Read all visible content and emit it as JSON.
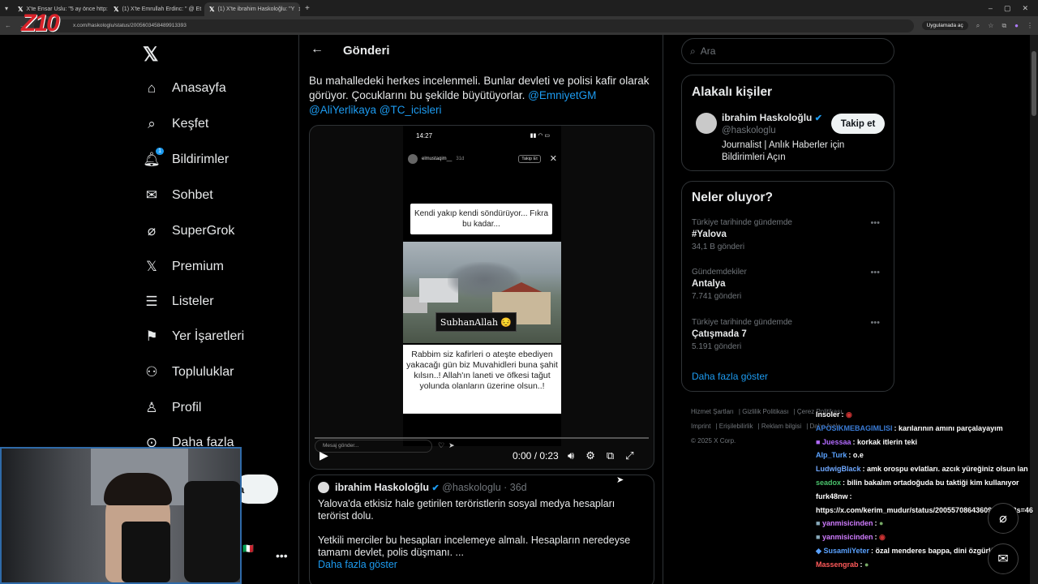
{
  "browser": {
    "tabs": [
      {
        "title": "X'te Ensar Uslu: \"5 ay önce http:",
        "active": false
      },
      {
        "title": "(1) X'te Emrullah Erdinc: \" @ Et",
        "active": false
      },
      {
        "title": "(1) X'te ibrahim Haskoloğlu: \"Y",
        "active": true
      }
    ],
    "new_tab": "+",
    "url": "x.com/haskologlu/status/2005603458489913393",
    "paused_label": "Uygulamada aç"
  },
  "nav": {
    "items": [
      {
        "label": "Anasayfa",
        "icon": "home-icon"
      },
      {
        "label": "Keşfet",
        "icon": "search-icon"
      },
      {
        "label": "Bildirimler",
        "icon": "bell-icon",
        "badge": "1"
      },
      {
        "label": "Sohbet",
        "icon": "mail-icon"
      },
      {
        "label": "SuperGrok",
        "icon": "grok-icon"
      },
      {
        "label": "Premium",
        "icon": "x-premium-icon"
      },
      {
        "label": "Listeler",
        "icon": "list-icon"
      },
      {
        "label": "Yer İşaretleri",
        "icon": "bookmark-icon"
      },
      {
        "label": "Topluluklar",
        "icon": "communities-icon"
      },
      {
        "label": "Profil",
        "icon": "profile-icon"
      },
      {
        "label": "Daha fazla",
        "icon": "more-circle-icon"
      }
    ],
    "post_button": "a"
  },
  "post": {
    "header": "Gönderi",
    "text": "Bu mahalledeki herkes incelenmeli. Bunlar devleti ve polisi kafir olarak görüyor. Çocuklarını bu şekilde büyütüyorlar.",
    "mentions": [
      "@EmniyetGM",
      "@AliYerlikaya",
      "@TC_icisleri"
    ],
    "video": {
      "phone_time": "14:27",
      "story_user": "elmustaqim__",
      "story_age": "31d",
      "story_follow": "Takip Et",
      "caption_top": "Kendi yakıp kendi söndürüyor... Fıkra bu kadar...",
      "subhan": "SubhanAllah 😔",
      "caption_bottom": "Rabbim siz kafirleri o ateşte ebediyen yakacağı gün biz Muvahidleri buna şahit kılsın..! Allah'ın laneti ve öfkesi tağut yolunda olanların üzerine olsun..!",
      "message_placeholder": "Mesaj gönder...",
      "time": "0:00 / 0:23"
    }
  },
  "reply": {
    "name": "ibrahim Haskoloğlu",
    "handle": "@haskologlu · 36d",
    "text": "Yalova'da etkisiz hale getirilen teröristlerin sosyal medya hesapları terörist dolu.\n\nYetkili merciler bu hesapları incelemeye almalı. Hesapların neredeyse tamamı devlet, polis düşmanı. ...",
    "more": "Daha fazla göster"
  },
  "right": {
    "search_placeholder": "Ara",
    "related": {
      "title": "Alakalı kişiler",
      "name": "ibrahim Haskoloğlu",
      "handle": "@haskologlu",
      "bio": "Journalist | Anlık Haberler için Bildirimleri Açın",
      "follow": "Takip et"
    },
    "trends": {
      "title": "Neler oluyor?",
      "items": [
        {
          "category": "Türkiye tarihinde gündemde",
          "name": "#Yalova",
          "count": "34,1 B gönderi"
        },
        {
          "category": "Gündemdekiler",
          "name": "Antalya",
          "count": "7.741 gönderi"
        },
        {
          "category": "Türkiye tarihinde gündemde",
          "name": "Çatışmada 7",
          "count": "5.191 gönderi"
        }
      ],
      "more": "Daha fazla göster"
    },
    "footer": {
      "links": [
        "Hizmet Şartları",
        "Gizlilik Politikası",
        "Çerez Politikası",
        "Imprint",
        "Erişilebilirlik",
        "Reklam bilgisi",
        "Daha fazla"
      ],
      "copyright": "© 2025 X Corp."
    }
  },
  "chat": [
    {
      "user": "Insoler",
      "color": "#ffffff",
      "msg": ""
    },
    {
      "user": "APOSIKMEBAGIMLISI",
      "color": "#3a7bd5",
      "msg": "karılarının amını parçalayayım"
    },
    {
      "user": "Juessaa",
      "color": "#b36bff",
      "msg": "korkak itlerin teki"
    },
    {
      "user": "Alp_Turk",
      "color": "#5aa2ff",
      "msg": "o.e"
    },
    {
      "user": "LudwigBlack",
      "color": "#6fa8ff",
      "msg": "amk orospu evlatları. azcık yüreğiniz olsun lan"
    },
    {
      "user": "seadox",
      "color": "#4ac26b",
      "msg": "bilin bakalım ortadoğuda bu taktiği kim kullanıyor"
    },
    {
      "user": "furk48nw",
      "color": "#ffffff",
      "msg": "https://x.com/kerim_mudur/status/2005570864360907042?s=46"
    },
    {
      "user": "yanmisicinden",
      "color": "#d07cff",
      "msg": ""
    },
    {
      "user": "yanmisicinden",
      "color": "#d07cff",
      "msg": ""
    },
    {
      "user": "SusamliYeter",
      "color": "#5aa2ff",
      "msg": "özal menderes bappa, dini özgürlük"
    },
    {
      "user": "Massengrab",
      "color": "#ff5a5a",
      "msg": ""
    }
  ]
}
